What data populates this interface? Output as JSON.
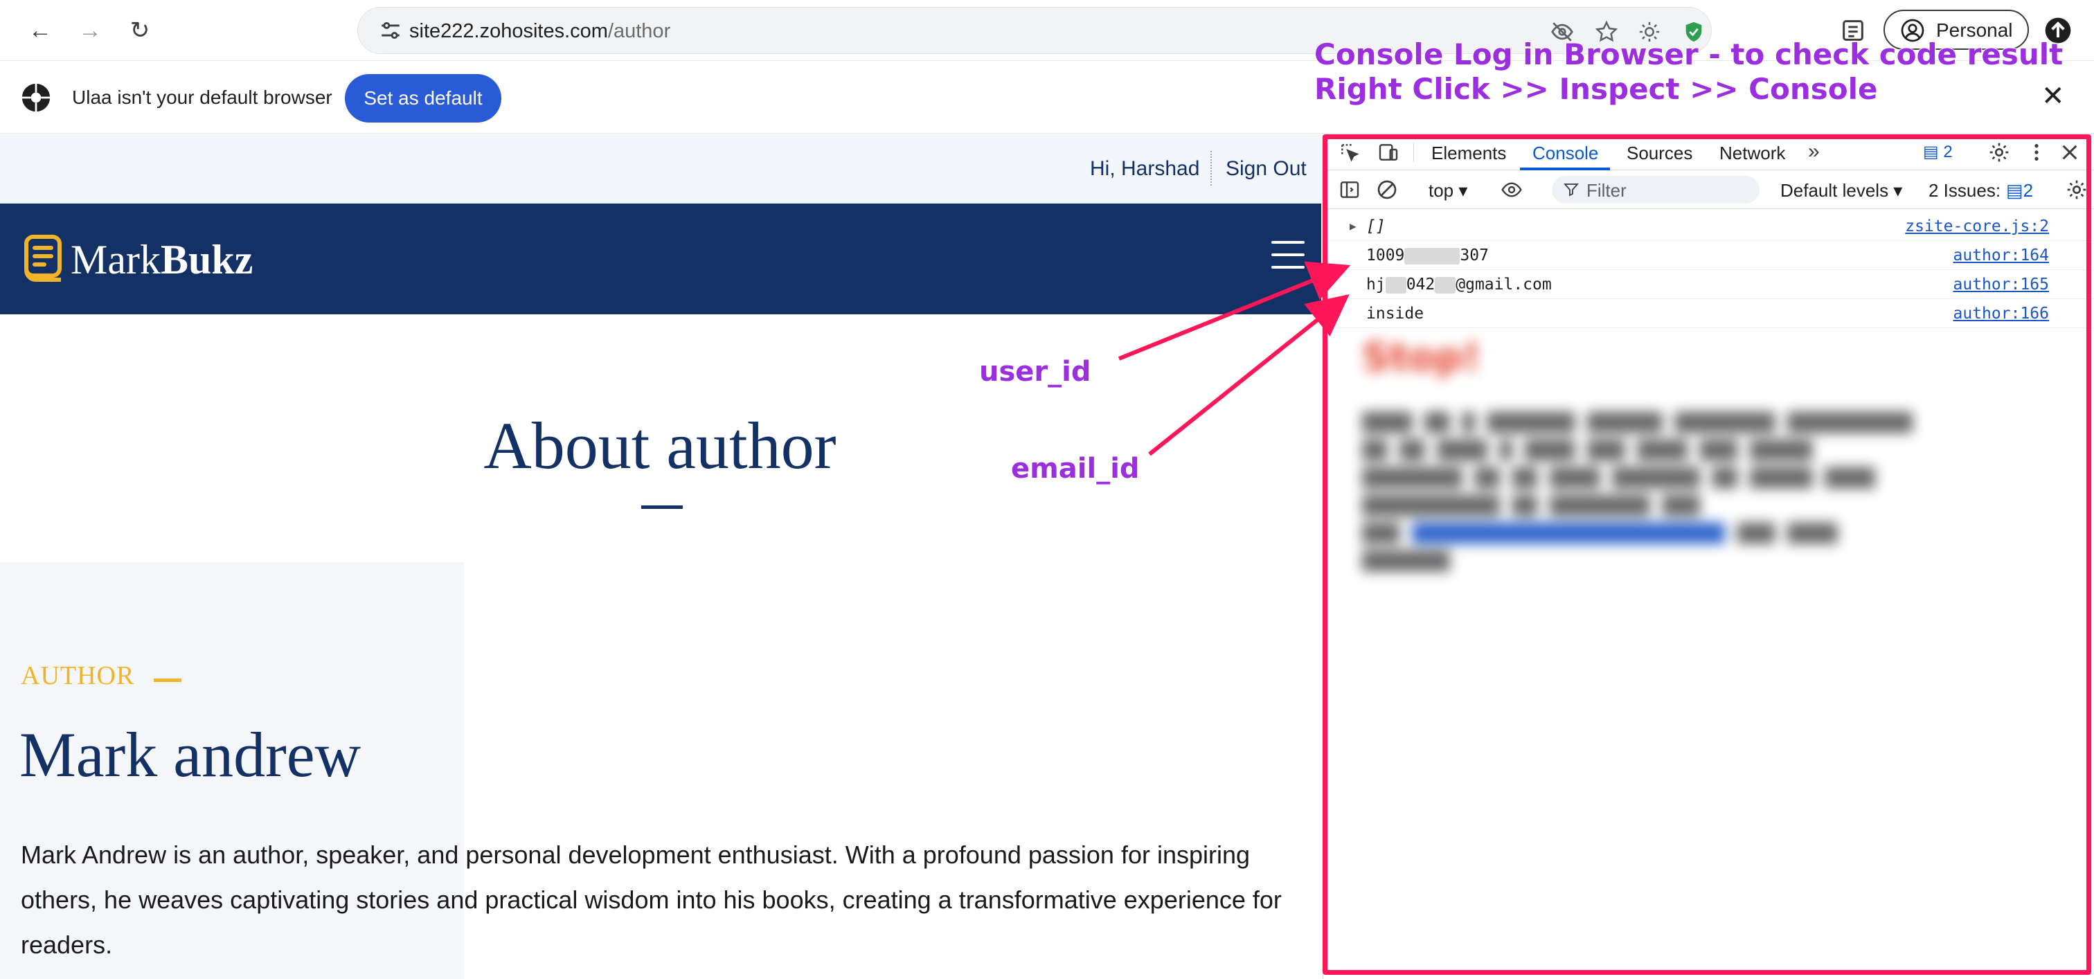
{
  "browser": {
    "url_host": "site222.zohosites.com",
    "url_path": "/author",
    "profile_label": "Personal",
    "icons": [
      "back-icon",
      "forward-icon",
      "reload-icon",
      "tune-icon",
      "eye-off-icon",
      "star-icon",
      "sun-icon",
      "shield-icon",
      "reading-list-icon",
      "avatar-icon",
      "update-icon"
    ]
  },
  "infobar": {
    "message": "Ulaa isn't your default browser",
    "button_label": "Set as default",
    "close_glyph": "✕"
  },
  "page": {
    "greeting": "Hi, Harshad",
    "signout": "Sign Out",
    "logo_part1": "Mark",
    "logo_part2": "Bukz",
    "about_title": "About author",
    "eyebrow": "AUTHOR",
    "author_name": "Mark andrew",
    "bio": "Mark Andrew is an author, speaker, and personal development enthusiast. With a profound passion for inspiring others, he weaves captivating stories and practical wisdom into his books, creating a transformative experience for readers.",
    "colors": {
      "navy": "#133165",
      "gold": "#f0b429",
      "panel": "#f4f6fa"
    }
  },
  "devtools": {
    "tabs": [
      "Elements",
      "Console",
      "Sources",
      "Network"
    ],
    "active_tab": "Console",
    "message_count": "2",
    "context": "top ▾",
    "filter_placeholder": "Filter",
    "levels": "Default levels ▾",
    "issues_label": "2 Issues:",
    "issues_count": "2",
    "logs": [
      {
        "message": "[]",
        "source": "zsite-core.js:2"
      },
      {
        "message_start": "1009",
        "message_end": "307",
        "source": "author:164"
      },
      {
        "message_start": "hj",
        "message_mid": "042",
        "message_end": "@gmail.com",
        "source": "author:165"
      },
      {
        "message": "inside",
        "source": "author:166"
      }
    ],
    "blurred_stop": "Stop!",
    "accent": "#0b57d0"
  },
  "annotations": {
    "title_line1": "Console Log in Browser - to check code result",
    "title_line2": "Right Click >> Inspect >> Console",
    "user_id": "user_id",
    "email_id": "email_id",
    "color": "#9b2fe0",
    "highlight_color": "#ff1659"
  }
}
